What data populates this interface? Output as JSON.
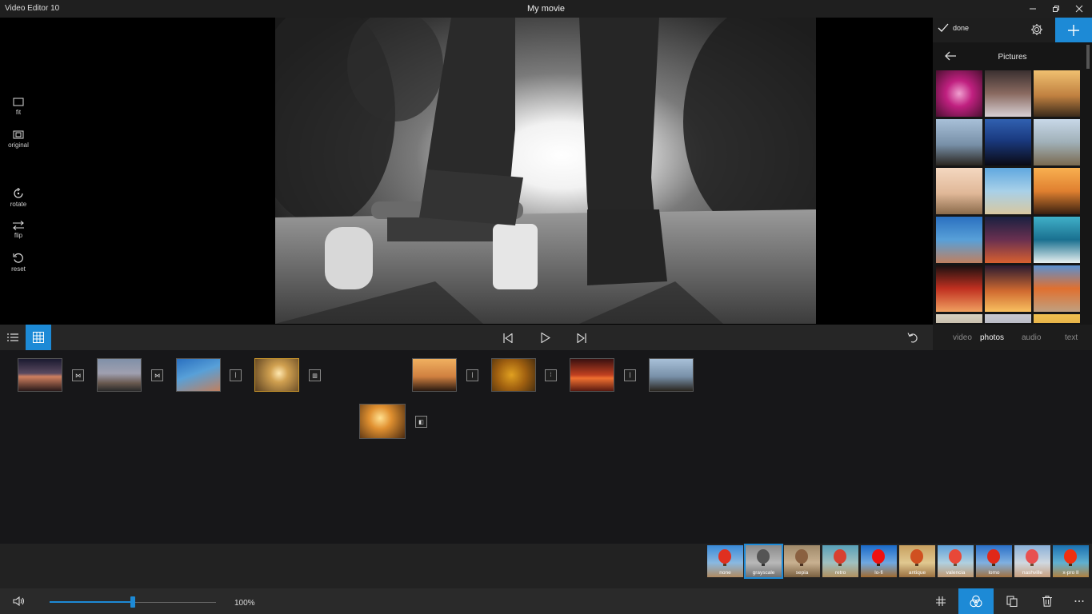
{
  "window": {
    "app_title": "Video Editor 10",
    "doc_title": "My movie"
  },
  "left_tools": [
    {
      "label": "fit",
      "icon": "fit-icon"
    },
    {
      "label": "original",
      "icon": "original-size-icon"
    },
    {
      "label": "rotate",
      "icon": "rotate-icon"
    },
    {
      "label": "flip",
      "icon": "flip-icon"
    },
    {
      "label": "reset",
      "icon": "reset-icon"
    }
  ],
  "right_panel": {
    "done_label": "done",
    "section_title": "Pictures"
  },
  "media_tabs": {
    "video": "video",
    "photos": "photos",
    "audio": "audio",
    "text": "text",
    "active": "photos"
  },
  "filters": {
    "items": [
      "none",
      "grayscale",
      "sepia",
      "retro",
      "lo-fi",
      "antique",
      "valencia",
      "lomo",
      "nashville",
      "x-pro II"
    ],
    "selected": "grayscale"
  },
  "volume": {
    "value_text": "100%",
    "level": 0.5
  },
  "colors": {
    "accent": "#1d8ad6",
    "selected_clip_border": "#c9962c"
  }
}
